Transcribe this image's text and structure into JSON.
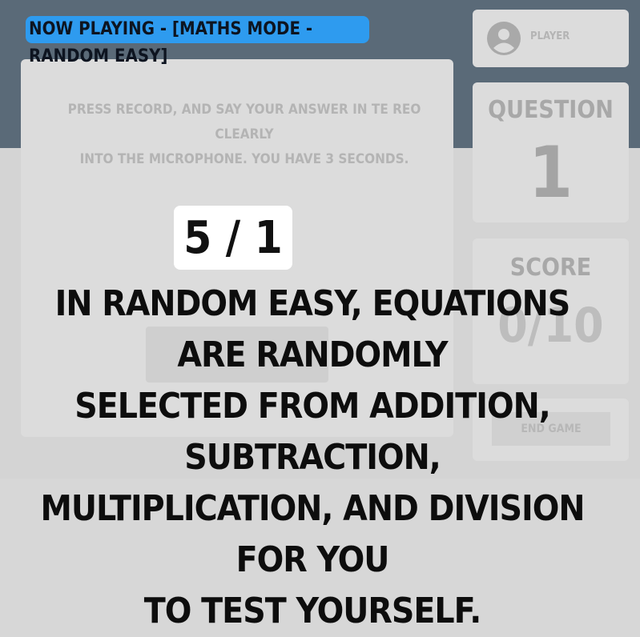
{
  "header": {
    "now_playing": "NOW PLAYING - [MATHS MODE - RANDOM EASY]"
  },
  "main": {
    "instruction_line1": "PRESS RECORD, AND SAY YOUR ANSWER IN TE REO CLEARLY",
    "instruction_line2": "INTO THE MICROPHONE. YOU HAVE 3 SECONDS."
  },
  "player": {
    "icon": "account-circle-icon",
    "label": "PLAYER"
  },
  "question": {
    "label": "QUESTION",
    "number": "1"
  },
  "score": {
    "label": "SCORE",
    "value": "0/10"
  },
  "end_game": {
    "label": "END GAME"
  },
  "overlay": {
    "equation": "5 / 1",
    "line1": "IN RANDOM EASY, EQUATIONS ARE RANDOMLY",
    "line2": "SELECTED FROM ADDITION, SUBTRACTION,",
    "line3": "MULTIPLICATION, AND DIVISION FOR YOU",
    "line4": "TO TEST YOURSELF."
  },
  "colors": {
    "accent": "#2e9bef",
    "top_band": "#5a6a78",
    "background": "#d4d4d4"
  }
}
